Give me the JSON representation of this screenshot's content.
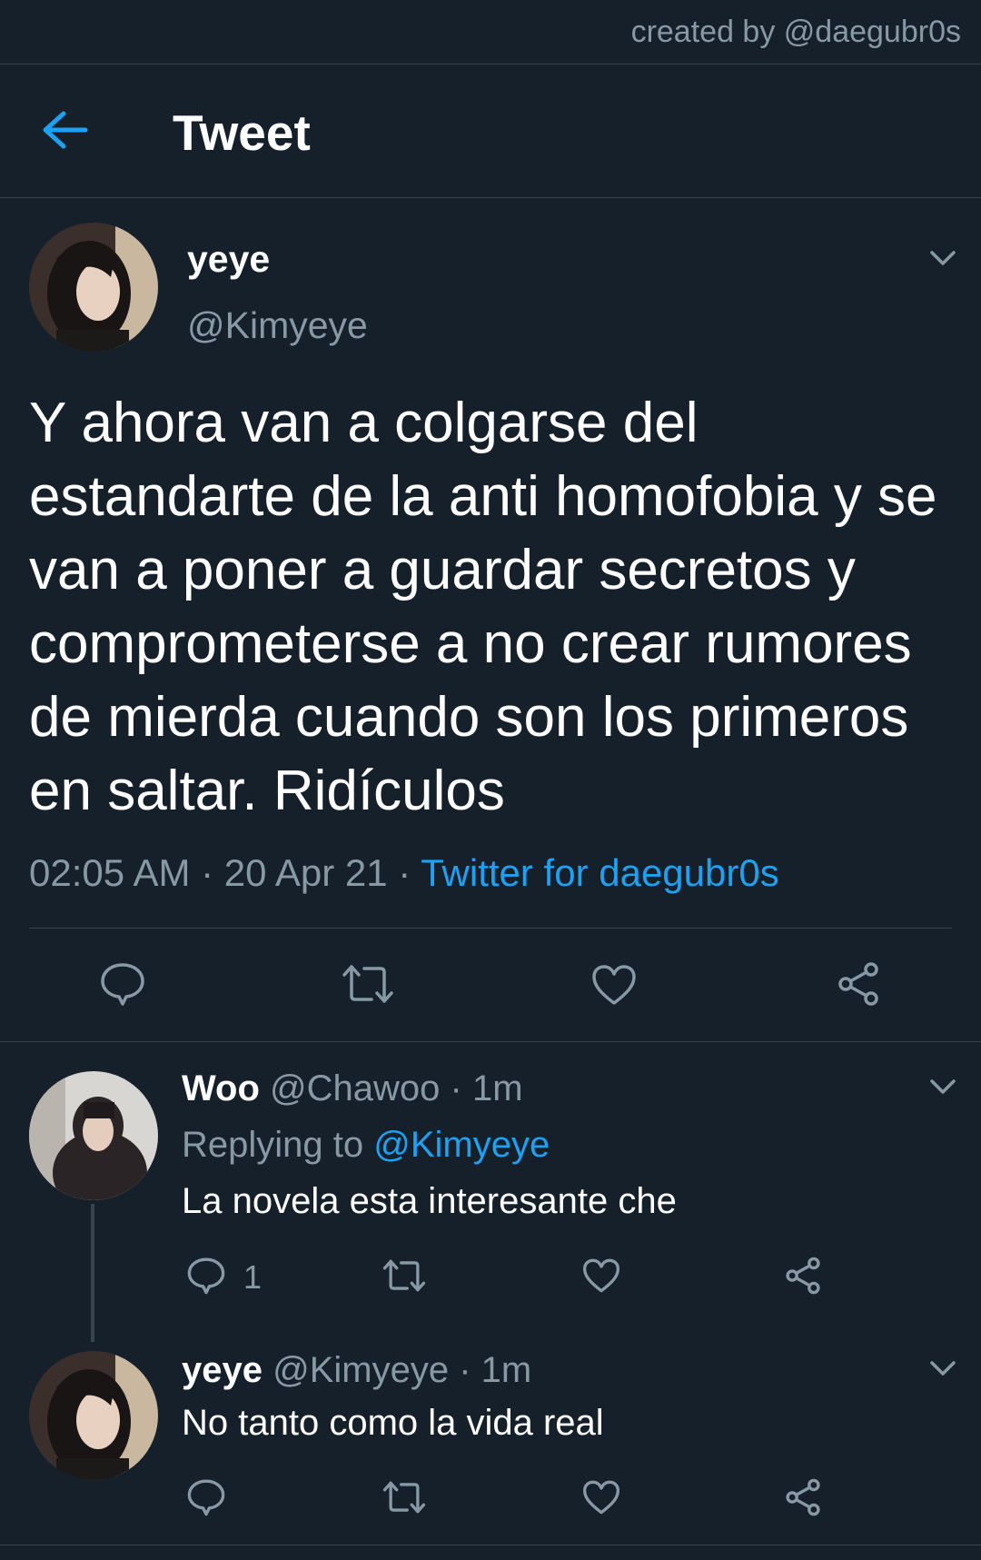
{
  "watermark": "created by @daegubr0s",
  "header": {
    "title": "Tweet"
  },
  "main_tweet": {
    "display_name": "yeye",
    "handle": "@Kimyeye",
    "text": "Y ahora van a colgarse del estandarte de la anti homofobia y se van a poner a guardar secretos y comprometerse a no crear rumores de mierda cuando son los primeros en saltar. Ridículos",
    "time": "02:05 AM",
    "date": "20 Apr 21",
    "separator": " · ",
    "source": "Twitter for daegubr0s"
  },
  "replies": [
    {
      "display_name": "Woo",
      "handle": "@Chawoo",
      "age": "· 1m",
      "replying_label": "Replying to",
      "replying_handle": "@Kimyeye",
      "text": "La novela esta interesante che",
      "reply_count": "1"
    },
    {
      "display_name": "yeye",
      "handle": "@Kimyeye",
      "age": "· 1m",
      "text": "No tanto como la vida real"
    }
  ],
  "icons": {
    "back": "arrow-left-icon",
    "chevron": "chevron-down-icon",
    "reply": "speech-bubble-icon",
    "retweet": "retweet-icon",
    "like": "heart-icon",
    "share": "share-icon"
  },
  "colors": {
    "background": "#15202b",
    "accent": "#1da1f2",
    "muted": "#8899a6",
    "divider": "#38444d"
  }
}
